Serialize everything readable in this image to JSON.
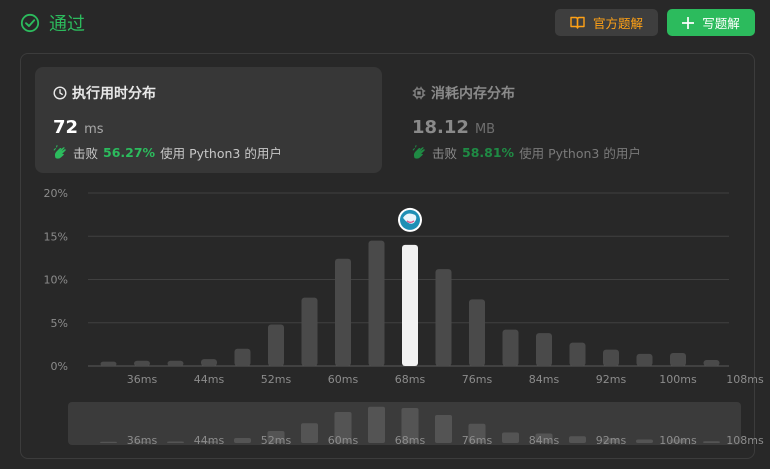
{
  "status": {
    "title": "通过",
    "icon": "check-circle-icon",
    "color": "#2cbb5d"
  },
  "buttons": {
    "solution_label": "官方题解",
    "solution_icon": "book-open-icon",
    "write_label": "写题解",
    "write_icon": "plus-icon"
  },
  "runtime": {
    "title": "执行用时分布",
    "icon": "clock-icon",
    "value": "72",
    "unit": "ms",
    "beats_label": "击败",
    "beats_pct": "56.27%",
    "beats_suffix": "使用 Python3 的用户",
    "beats_icon": "clapping-hands-icon"
  },
  "memory": {
    "title": "消耗内存分布",
    "icon": "chip-icon",
    "value": "18.12",
    "unit": "MB",
    "beats_label": "击败",
    "beats_pct": "58.81%",
    "beats_suffix": "使用 Python3 的用户",
    "beats_icon": "clapping-hands-icon"
  },
  "chart_data": {
    "type": "bar",
    "title": "",
    "xlabel": "",
    "ylabel": "",
    "ylim": [
      0,
      20
    ],
    "y_ticks": [
      "0%",
      "5%",
      "10%",
      "15%",
      "20%"
    ],
    "grid": true,
    "x_tick_labels": [
      "36ms",
      "44ms",
      "52ms",
      "60ms",
      "68ms",
      "76ms",
      "84ms",
      "92ms",
      "100ms",
      "108ms"
    ],
    "categories": [
      "34ms",
      "38ms",
      "42ms",
      "46ms",
      "50ms",
      "54ms",
      "58ms",
      "62ms",
      "66ms",
      "70ms",
      "74ms",
      "78ms",
      "82ms",
      "86ms",
      "90ms",
      "94ms",
      "98ms",
      "102ms",
      "106ms",
      "110ms"
    ],
    "values": [
      0.5,
      0.6,
      0.6,
      0.8,
      2.0,
      4.8,
      7.9,
      12.4,
      14.5,
      14.0,
      11.2,
      7.7,
      4.2,
      3.8,
      2.7,
      1.9,
      1.4,
      1.5,
      0.7,
      0
    ],
    "highlight_index": 9,
    "bar_color": "#4a4a4a",
    "highlight_color": "#f2f2f2",
    "marker_icon": "user-avatar-icon"
  }
}
